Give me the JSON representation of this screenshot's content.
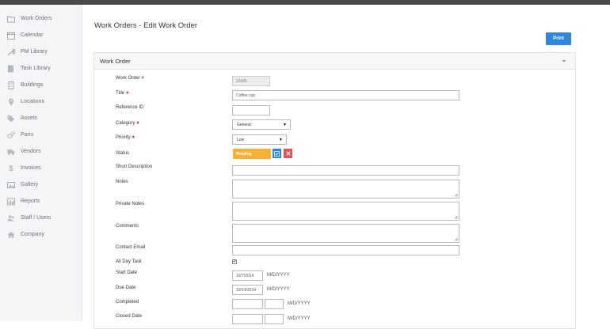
{
  "sidebar": {
    "items": [
      {
        "label": "Work Orders",
        "icon": "folder-icon"
      },
      {
        "label": "Calendar",
        "icon": "calendar-icon"
      },
      {
        "label": "PM Library",
        "icon": "wrench-icon"
      },
      {
        "label": "Task Library",
        "icon": "book-icon"
      },
      {
        "label": "Buildings",
        "icon": "building-icon"
      },
      {
        "label": "Locations",
        "icon": "map-pin-icon"
      },
      {
        "label": "Assets",
        "icon": "tag-icon"
      },
      {
        "label": "Parts",
        "icon": "cogs-icon"
      },
      {
        "label": "Vendors",
        "icon": "truck-icon"
      },
      {
        "label": "Invoices",
        "icon": "dollar-icon"
      },
      {
        "label": "Gallery",
        "icon": "image-icon"
      },
      {
        "label": "Reports",
        "icon": "bar-chart-icon"
      },
      {
        "label": "Staff / Users",
        "icon": "users-icon"
      },
      {
        "label": "Company",
        "icon": "home-icon"
      }
    ]
  },
  "header": {
    "title": "Work Orders - Edit Work Order",
    "print_label": "Print"
  },
  "panel": {
    "title": "Work Order"
  },
  "form": {
    "work_order_no": {
      "label": "Work Order #",
      "value": "23685"
    },
    "title": {
      "label": "Title",
      "value": "Coffee cup"
    },
    "reference_id": {
      "label": "Reference ID",
      "value": ""
    },
    "category": {
      "label": "Category",
      "value": "General"
    },
    "priority": {
      "label": "Priority",
      "value": "Low"
    },
    "status": {
      "label": "Status",
      "value": "Pending"
    },
    "short_description": {
      "label": "Short Description",
      "value": ""
    },
    "notes": {
      "label": "Notes"
    },
    "private_notes": {
      "label": "Private Notes"
    },
    "comments": {
      "label": "Comments"
    },
    "contact_email": {
      "label": "Contact Email",
      "value": ""
    },
    "all_day_task": {
      "label": "All Day Task",
      "checked": true
    },
    "start_date": {
      "label": "Start Date",
      "value": "10/7/2014",
      "format": "M/D/YYYY"
    },
    "due_date": {
      "label": "Due Date",
      "value": "10/14/2014",
      "format": "M/D/YYYY"
    },
    "completed": {
      "label": "Completed",
      "format": "M/D/YYYY"
    },
    "closed_date": {
      "label": "Closed Date",
      "format": "M/D/YYYY"
    }
  },
  "colors": {
    "accent": "#2e86de",
    "status_pending": "#f6b132",
    "edit_button": "#2e86de",
    "remove_button": "#e55353",
    "required_mark": "#e53935"
  }
}
